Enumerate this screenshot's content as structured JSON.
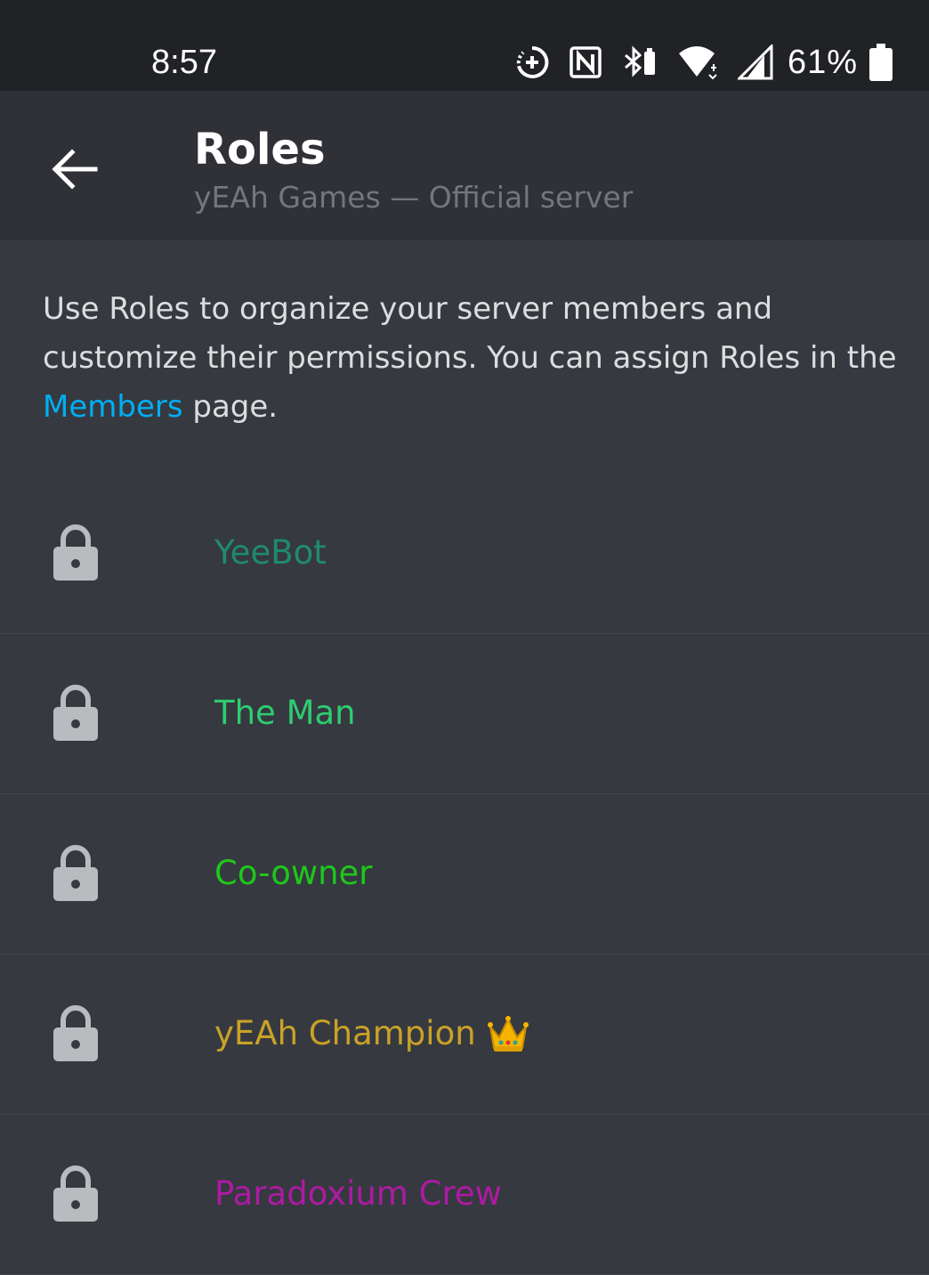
{
  "status_bar": {
    "time": "8:57",
    "battery_percent": "61%",
    "icons": [
      "data-saver-icon",
      "nfc-icon",
      "bluetooth-icon",
      "wifi-icon",
      "cell-signal-icon",
      "battery-icon"
    ]
  },
  "header": {
    "title": "Roles",
    "subtitle": "yEAh Games — Official server",
    "back_icon": "back-arrow-icon"
  },
  "description": {
    "part1": "Use Roles to organize your server members and customize their permissions. You can assign Roles in the ",
    "link": "Members",
    "part2": " page."
  },
  "roles": [
    {
      "name": "YeeBot",
      "color": "#1f8b6c",
      "emoji": ""
    },
    {
      "name": "The Man",
      "color": "#2ecc71",
      "emoji": ""
    },
    {
      "name": "Co-owner",
      "color": "#1ec71c",
      "emoji": ""
    },
    {
      "name": "yEAh Champion",
      "color": "#c9a227",
      "emoji": "crown-icon"
    },
    {
      "name": "Paradoxium Crew",
      "color": "#ad1aa3",
      "emoji": ""
    }
  ],
  "colors": {
    "background": "#36393f",
    "header_bg": "#2f3136",
    "status_bg": "#202225",
    "link": "#00aff4",
    "lock_icon": "#b9bbbe"
  }
}
